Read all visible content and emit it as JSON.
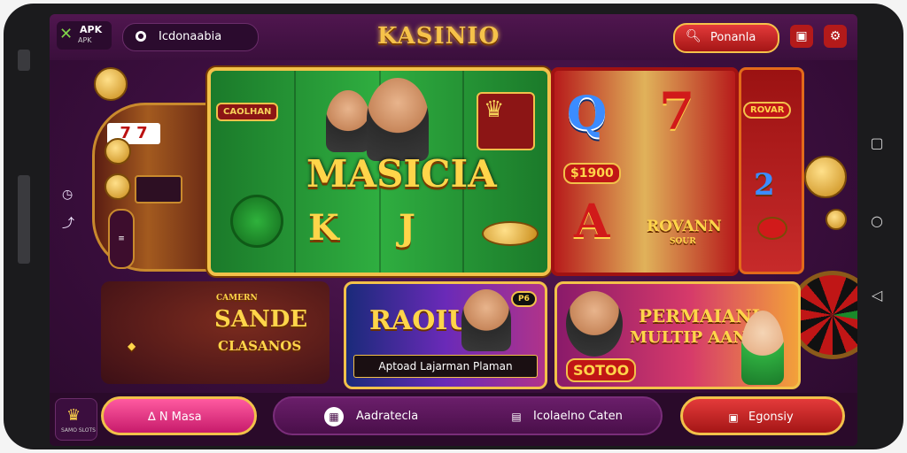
{
  "topbar": {
    "apk_brand": "APK",
    "apk_sub": "APK",
    "location_label": "Icdonaabia",
    "app_title": "KASINIO",
    "search_label": "Ponanla"
  },
  "main_banner": {
    "badge_left": "CAOLHAN",
    "headline": "MASICIA",
    "letter_k": "K",
    "letter_j": "J"
  },
  "slot_card": {
    "letter_q": "Q",
    "seven": "7",
    "letter_a": "A",
    "value": "$1900",
    "brand": "ROVANN",
    "brand_sub": "SOUR"
  },
  "side_card": {
    "badge": "ROVAR"
  },
  "promo_cards": [
    {
      "title": "SANDE",
      "subtitle": "CLASANOS",
      "tag": "CAMERN"
    },
    {
      "title": "RAOIU",
      "corner": "P6",
      "strip": "Aptoad Lajarman Plaman"
    },
    {
      "title": "PERMAIANI",
      "subtitle": "MULTIP AANEN",
      "value": "SOTOO"
    }
  ],
  "bottombar": {
    "logo_sub": "SAMO SLOTS",
    "primary_label": "∆ N Masa",
    "center_left_label": "Aadratecla",
    "center_right_label": "Icolaelno Caten",
    "right_label": "Egonsiy"
  },
  "icons": {
    "location": "location-pin-icon",
    "search": "search-icon",
    "store": "store-icon",
    "settings": "gear-icon"
  },
  "colors": {
    "background": "#3b0e3e",
    "gold": "#f6c24a",
    "red": "#c01616",
    "green": "#2fae40",
    "pink": "#e13c84"
  }
}
